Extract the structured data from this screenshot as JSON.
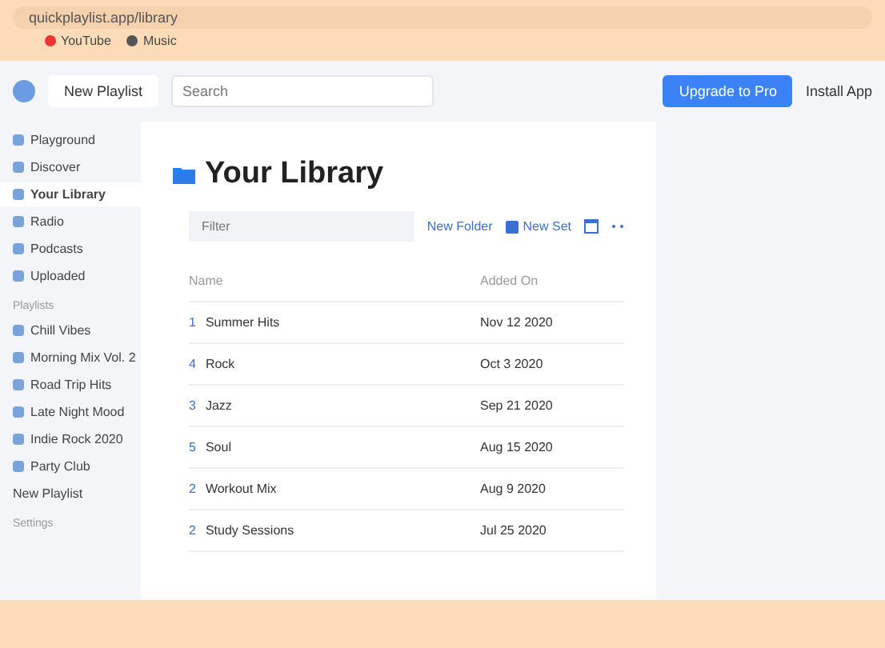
{
  "browser": {
    "address": "quickplaylist.app/library",
    "bookmarks": [
      {
        "label": "YouTube"
      },
      {
        "label": "Music"
      }
    ]
  },
  "header": {
    "new_button": "New Playlist",
    "search": {
      "placeholder": "Search"
    },
    "upgrade_button": "Upgrade to Pro",
    "account": "Install App"
  },
  "sidebar": {
    "items": [
      {
        "label": "Playground",
        "selected": false
      },
      {
        "label": "Discover",
        "selected": false
      },
      {
        "label": "Your Library",
        "selected": true
      },
      {
        "label": "Radio",
        "selected": false
      },
      {
        "label": "Podcasts",
        "selected": false
      },
      {
        "label": "Uploaded",
        "selected": false
      }
    ],
    "section": "Playlists",
    "playlists": [
      {
        "label": "Chill Vibes"
      },
      {
        "label": "Morning Mix Vol. 2"
      },
      {
        "label": "Road Trip Hits"
      },
      {
        "label": "Late Night Mood"
      },
      {
        "label": "Indie Rock 2020"
      },
      {
        "label": "Party Club"
      }
    ],
    "add": "New Playlist",
    "footer": "Settings"
  },
  "library": {
    "title": "Your Library",
    "filter": {
      "placeholder": "Filter"
    },
    "actions": [
      {
        "label": "New Folder",
        "kind": "text"
      },
      {
        "label": "New Set",
        "kind": "icon-text"
      }
    ],
    "table": {
      "columns": [
        "Name",
        "Added On"
      ],
      "rows": [
        {
          "index": "1",
          "name": "Summer Hits",
          "added": "Nov 12 2020"
        },
        {
          "index": "4",
          "name": "Rock",
          "added": "Oct 3 2020"
        },
        {
          "index": "3",
          "name": "Jazz",
          "added": "Sep 21 2020"
        },
        {
          "index": "5",
          "name": "Soul",
          "added": "Aug 15 2020"
        },
        {
          "index": "2",
          "name": "Workout Mix",
          "added": "Aug 9 2020"
        },
        {
          "index": "2",
          "name": "Study Sessions",
          "added": "Jul 25 2020"
        }
      ]
    }
  }
}
